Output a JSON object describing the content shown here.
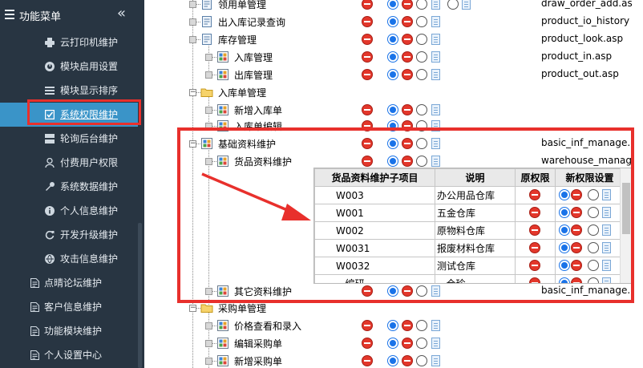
{
  "sidebar": {
    "title": "功能菜单",
    "collapse_glyph": "«",
    "sub_items": [
      {
        "label": "云打印机维护",
        "icon": "printer-icon"
      },
      {
        "label": "模块启用设置",
        "icon": "gauge-icon"
      },
      {
        "label": "模块显示排序",
        "icon": "list-icon"
      },
      {
        "label": "系统权限维护",
        "icon": "checkbox-icon",
        "active": true
      },
      {
        "label": "轮询后台维护",
        "icon": "server-icon"
      },
      {
        "label": "付费用户权限",
        "icon": "user-icon"
      },
      {
        "label": "系统数据维护",
        "icon": "wrench-icon"
      },
      {
        "label": "个人信息维护",
        "icon": "info-icon"
      },
      {
        "label": "开发升级维护",
        "icon": "refresh-icon"
      },
      {
        "label": "攻击信息维护",
        "icon": "globe-icon"
      }
    ],
    "top_items": [
      {
        "label": "点晴论坛维护",
        "icon": "doc-icon"
      },
      {
        "label": "客户信息维护",
        "icon": "doc-icon"
      },
      {
        "label": "功能模块维护",
        "icon": "doc-icon"
      },
      {
        "label": "个人设置中心",
        "icon": "doc-icon"
      }
    ]
  },
  "tree": [
    {
      "label": "领用单管理",
      "url": "draw_order_add.as"
    },
    {
      "label": "出入库记录查询",
      "url": "product_io_history"
    },
    {
      "label": "库存管理",
      "url": "product_look.asp"
    },
    {
      "label": "入库管理",
      "url": "product_in.asp"
    },
    {
      "label": "出库管理",
      "url": "product_out.asp"
    },
    {
      "label": "入库单管理",
      "url": ""
    },
    {
      "label": "新增入库单",
      "url": ""
    },
    {
      "label": "入库单编辑",
      "url": ""
    },
    {
      "label": "基础资料维护",
      "url": "basic_inf_manage."
    },
    {
      "label": "货品资料维护",
      "url": "warehouse_manag"
    },
    {
      "label": "其它资料维护",
      "url": "basic_inf_manage."
    },
    {
      "label": "采购单管理",
      "url": ""
    },
    {
      "label": "价格查看和录入",
      "url": ""
    },
    {
      "label": "编辑采购单",
      "url": ""
    },
    {
      "label": "新增采购单",
      "url": ""
    }
  ],
  "popup": {
    "headers": [
      "货品资料维护子项目",
      "说明",
      "原权限",
      "新权限设置"
    ],
    "rows": [
      {
        "code": "W003",
        "desc": "办公用品仓库"
      },
      {
        "code": "W001",
        "desc": "五金仓库"
      },
      {
        "code": "W002",
        "desc": "原物料仓库"
      },
      {
        "code": "W0031",
        "desc": "报废材料仓库"
      },
      {
        "code": "W0032",
        "desc": "测试仓库"
      },
      {
        "code": "...编研",
        "desc": "...仓珍"
      }
    ]
  },
  "colors": {
    "sidebar_bg": "#283542",
    "active_bg": "#3a94c8",
    "highlight": "#e8302c",
    "deny": "#e3372b",
    "allow": "#1a73e8"
  }
}
